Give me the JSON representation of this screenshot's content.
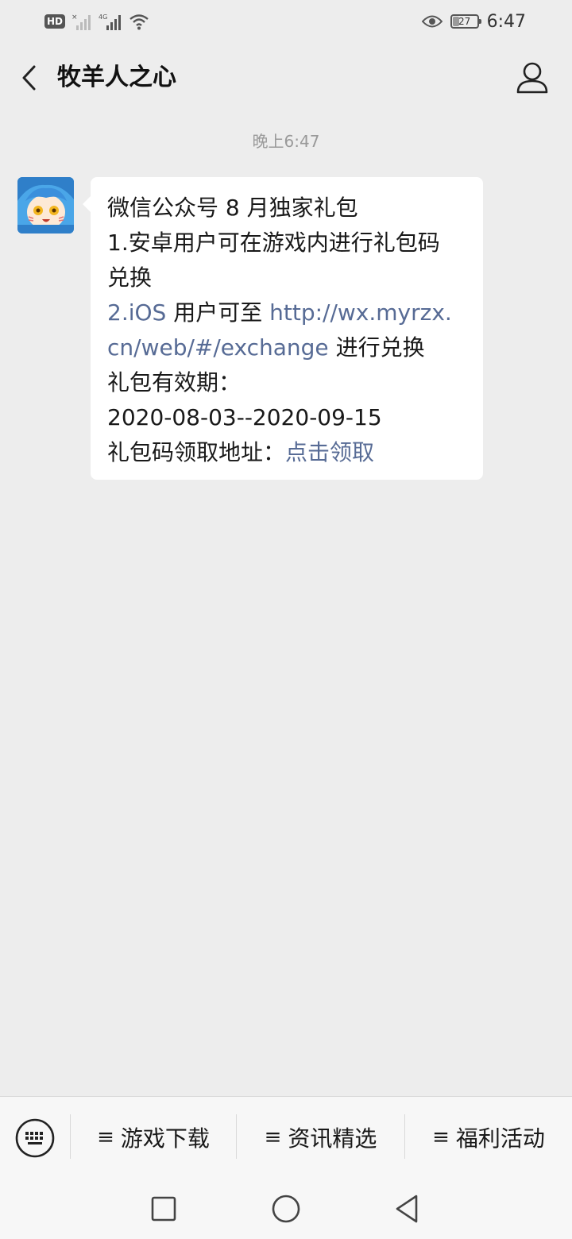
{
  "status_bar": {
    "network_badge": "HD",
    "network_type": "4G",
    "battery_level": "27",
    "time": "6:47"
  },
  "header": {
    "title": "牧羊人之心",
    "back_icon": "chevron-left-icon",
    "profile_icon": "person-icon"
  },
  "chat": {
    "timestamp": "晚上6:47",
    "message": {
      "line1": "微信公众号 8 月独家礼包",
      "line2": "1.安卓用户可在游戏内进行礼包码",
      "line3": "兑换",
      "line4_link": "2.iOS",
      "line4_text": " 用户可至 ",
      "line4_url": "http://wx.myrzx.",
      "line5_url": "cn/web/#/exchange",
      "line5_text": " 进行兑换",
      "line6": "礼包有效期：",
      "line7": "2020-08-03--2020-09-15",
      "line8_text": "礼包码领取地址：",
      "line8_link": "点击领取"
    }
  },
  "menu": {
    "keyboard_icon": "keyboard-icon",
    "items": [
      {
        "label": "游戏下载"
      },
      {
        "label": "资讯精选"
      },
      {
        "label": "福利活动"
      }
    ]
  },
  "nav": {
    "recent_icon": "square-icon",
    "home_icon": "circle-icon",
    "back_icon": "triangle-back-icon"
  },
  "colors": {
    "background": "#ededed",
    "link": "#576b95",
    "bubble": "#ffffff"
  }
}
